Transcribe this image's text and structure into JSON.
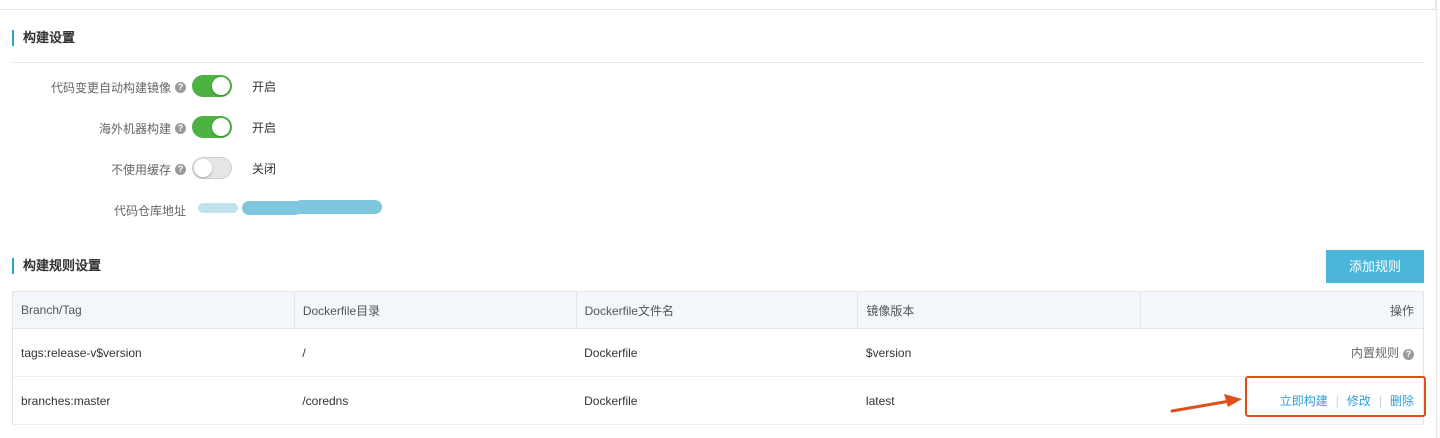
{
  "build_settings": {
    "title": "构建设置",
    "rows": [
      {
        "label": "代码变更自动构建镜像",
        "state": "开启",
        "on": true
      },
      {
        "label": "海外机器构建",
        "state": "开启",
        "on": true
      },
      {
        "label": "不使用缓存",
        "state": "关闭",
        "on": false
      }
    ],
    "repo_label": "代码仓库地址"
  },
  "rules": {
    "title": "构建规则设置",
    "add_button": "添加规则",
    "columns": [
      "Branch/Tag",
      "Dockerfile目录",
      "Dockerfile文件名",
      "镜像版本",
      "操作"
    ],
    "rows": [
      {
        "branch_tag": "tags:release-v$version",
        "dir": "/",
        "filename": "Dockerfile",
        "version": "$version",
        "op_builtin": "内置规则"
      },
      {
        "branch_tag": "branches:master",
        "dir": "/coredns",
        "filename": "Dockerfile",
        "version": "latest",
        "op_build": "立即构建",
        "op_edit": "修改",
        "op_delete": "删除"
      }
    ]
  },
  "colors": {
    "accent": "#2ea1c7",
    "toggle_on": "#4cb242",
    "button": "#4ab6d9",
    "link": "#2d9fd8",
    "annotation": "#e04f1b"
  }
}
